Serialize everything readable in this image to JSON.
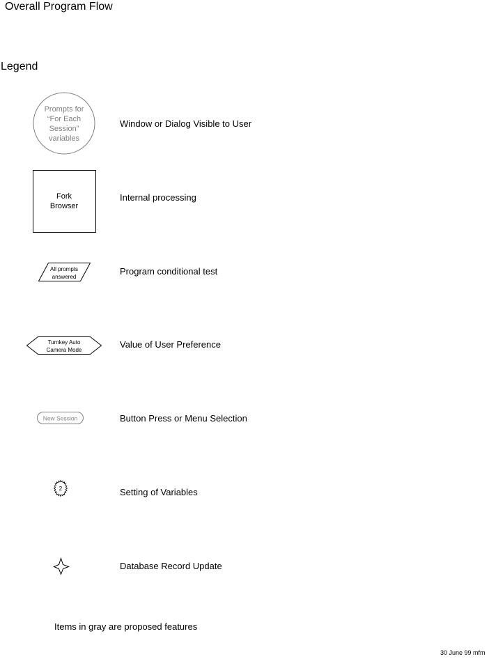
{
  "title": "Overall Program Flow",
  "legend_heading": "Legend",
  "legend": {
    "window": {
      "symbol_lines": [
        "Prompts for",
        "“For Each",
        "Session”",
        "variables"
      ],
      "description": "Window or Dialog Visible to User"
    },
    "internal": {
      "symbol_lines": [
        "Fork",
        "Browser"
      ],
      "description": "Internal processing"
    },
    "conditional": {
      "symbol_lines": [
        "All prompts",
        "answered"
      ],
      "description": "Program conditional test"
    },
    "preference": {
      "symbol_lines": [
        "Turnkey Auto",
        "Camera Mode"
      ],
      "description": "Value of User Preference"
    },
    "button": {
      "symbol_label": "New Session",
      "description": "Button Press or Menu Selection"
    },
    "variables": {
      "symbol_label": "2",
      "description": "Setting of Variables"
    },
    "database": {
      "description": "Database Record Update"
    }
  },
  "note": "Items in gray are proposed features",
  "footer": "30 June 99 mfm",
  "colors": {
    "proposed_gray": "#808080",
    "line": "#000000"
  }
}
